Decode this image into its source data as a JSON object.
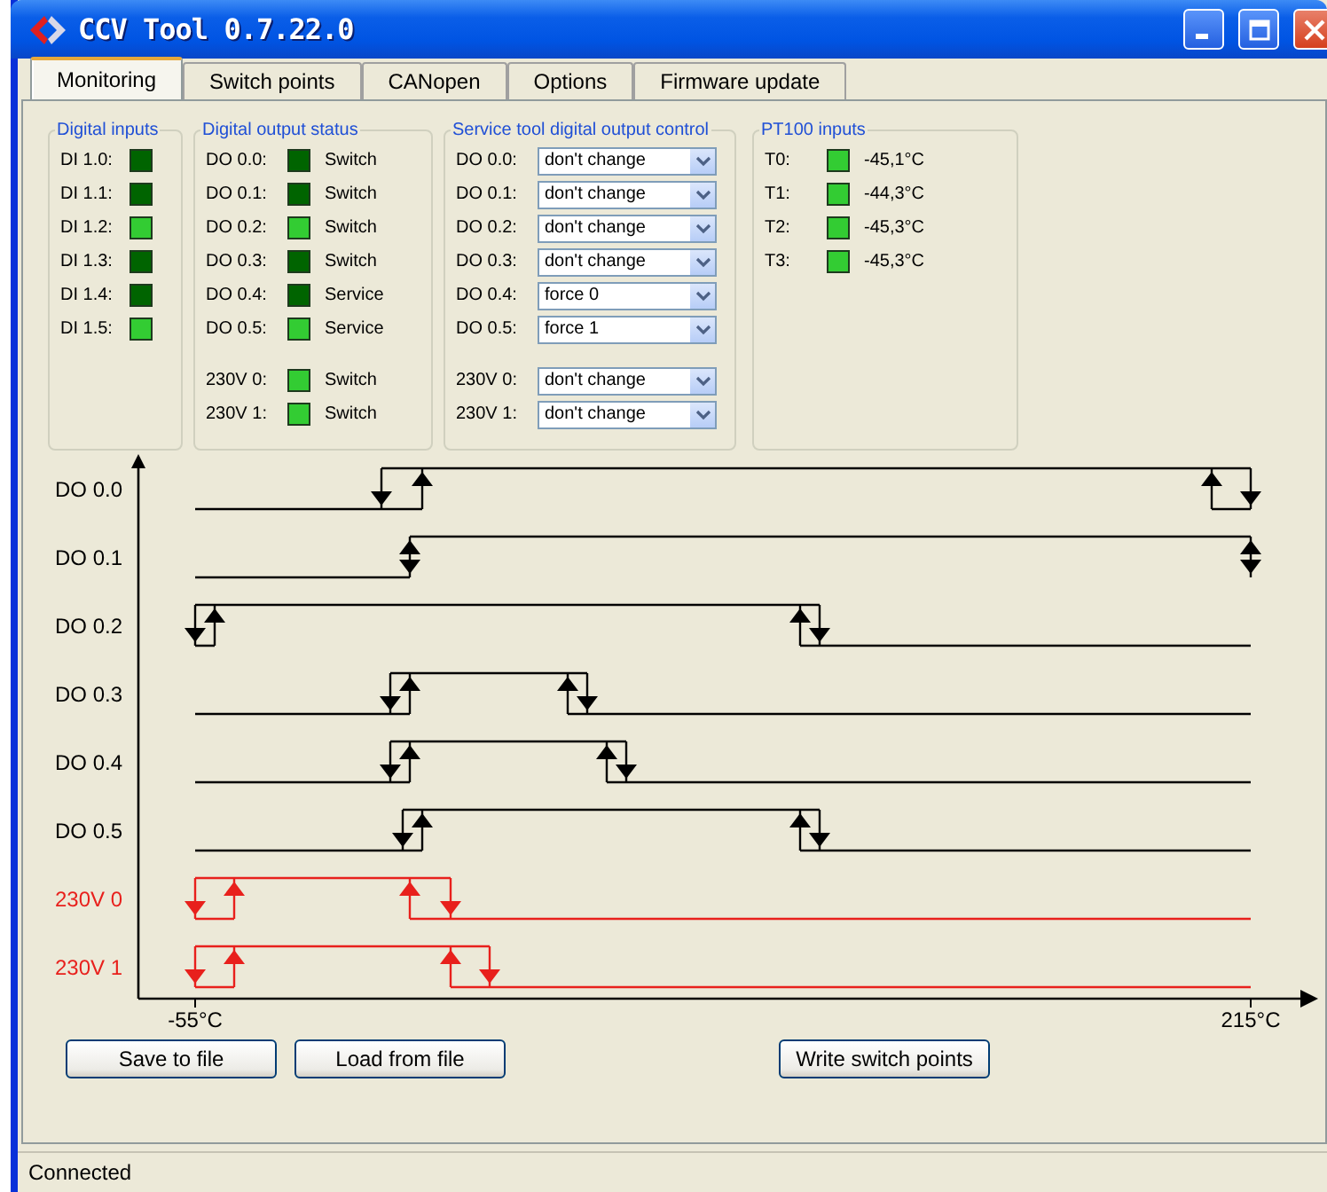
{
  "window": {
    "title": "CCV Tool 0.7.22.0"
  },
  "tabs": [
    {
      "label": "Monitoring",
      "selected": true
    },
    {
      "label": "Switch points",
      "selected": false
    },
    {
      "label": "CANopen",
      "selected": false
    },
    {
      "label": "Options",
      "selected": false
    },
    {
      "label": "Firmware update",
      "selected": false
    }
  ],
  "digital_inputs": {
    "title": "Digital inputs",
    "items": [
      {
        "label": "DI 1.0:",
        "on": false
      },
      {
        "label": "DI 1.1:",
        "on": false
      },
      {
        "label": "DI 1.2:",
        "on": true
      },
      {
        "label": "DI 1.3:",
        "on": false
      },
      {
        "label": "DI 1.4:",
        "on": false
      },
      {
        "label": "DI 1.5:",
        "on": true
      }
    ]
  },
  "digital_output_status": {
    "title": "Digital output status",
    "items": [
      {
        "label": "DO 0.0:",
        "on": false,
        "mode": "Switch"
      },
      {
        "label": "DO 0.1:",
        "on": false,
        "mode": "Switch"
      },
      {
        "label": "DO 0.2:",
        "on": true,
        "mode": "Switch"
      },
      {
        "label": "DO 0.3:",
        "on": false,
        "mode": "Switch"
      },
      {
        "label": "DO 0.4:",
        "on": false,
        "mode": "Service"
      },
      {
        "label": "DO 0.5:",
        "on": true,
        "mode": "Service"
      }
    ],
    "relay_items": [
      {
        "label": "230V 0:",
        "on": true,
        "mode": "Switch"
      },
      {
        "label": "230V 1:",
        "on": true,
        "mode": "Switch"
      }
    ]
  },
  "service_control": {
    "title": "Service tool digital output control",
    "items": [
      {
        "label": "DO 0.0:",
        "value": "don't change"
      },
      {
        "label": "DO 0.1:",
        "value": "don't change"
      },
      {
        "label": "DO 0.2:",
        "value": "don't change"
      },
      {
        "label": "DO 0.3:",
        "value": "don't change"
      },
      {
        "label": "DO 0.4:",
        "value": "force 0"
      },
      {
        "label": "DO 0.5:",
        "value": "force 1"
      }
    ],
    "relay_items": [
      {
        "label": "230V 0:",
        "value": "don't change"
      },
      {
        "label": "230V 1:",
        "value": "don't change"
      }
    ]
  },
  "pt100_inputs": {
    "title": "PT100 inputs",
    "items": [
      {
        "label": "T0:",
        "on": true,
        "reading": "-45,1°C"
      },
      {
        "label": "T1:",
        "on": true,
        "reading": "-44,3°C"
      },
      {
        "label": "T2:",
        "on": true,
        "reading": "-45,3°C"
      },
      {
        "label": "T3:",
        "on": true,
        "reading": "-45,3°C"
      }
    ]
  },
  "diagram": {
    "channels": [
      {
        "label": "DO 0.0",
        "color": "#000000"
      },
      {
        "label": "DO 0.1",
        "color": "#000000"
      },
      {
        "label": "DO 0.2",
        "color": "#000000"
      },
      {
        "label": "DO 0.3",
        "color": "#000000"
      },
      {
        "label": "DO 0.4",
        "color": "#000000"
      },
      {
        "label": "DO 0.5",
        "color": "#000000"
      },
      {
        "label": "230V 0",
        "color": "#e8201c"
      },
      {
        "label": "230V 1",
        "color": "#e8201c"
      }
    ],
    "x_ticks": [
      "-55°C",
      "215°C"
    ]
  },
  "buttons": [
    "Save to file",
    "Load from file",
    "Write switch points"
  ],
  "status_bar": {
    "text": "Connected"
  }
}
